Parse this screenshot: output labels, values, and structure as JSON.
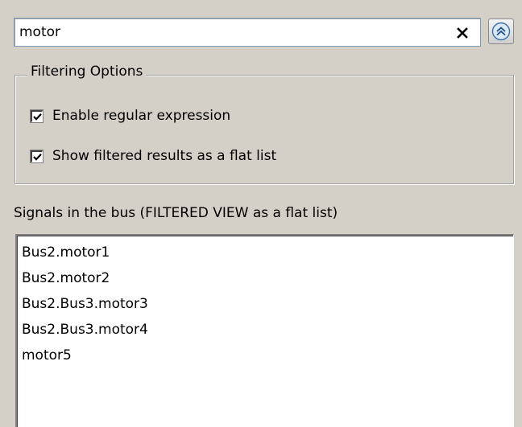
{
  "search": {
    "value": "motor"
  },
  "filtering_options": {
    "legend": "Filtering Options",
    "enable_regex": {
      "label": "Enable regular expression",
      "checked": true
    },
    "flat_list": {
      "label": "Show filtered results as a flat list",
      "checked": true
    }
  },
  "signals": {
    "label": "Signals in the bus (FILTERED VIEW as a flat list)",
    "items": [
      "Bus2.motor1",
      "Bus2.motor2",
      "Bus2.Bus3.motor3",
      "Bus2.Bus3.motor4",
      "motor5"
    ]
  },
  "icons": {
    "clear": "close-icon",
    "collapse": "chevron-up-icon"
  },
  "colors": {
    "background": "#d4d0c8",
    "field_border": "#7f9db9"
  }
}
